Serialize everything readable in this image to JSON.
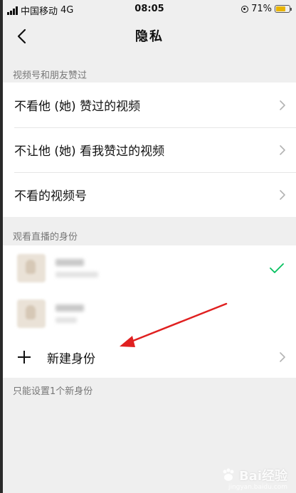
{
  "status_bar": {
    "carrier": "中国移动",
    "network": "4G",
    "time": "08:05",
    "battery": "71%",
    "battery_level": 0.71
  },
  "nav": {
    "title": "隐私"
  },
  "section_likes": {
    "header": "视频号和朋友赞过",
    "rows": [
      {
        "label": "不看他 (她) 赞过的视频"
      },
      {
        "label": "不让他 (她) 看我赞过的视频"
      },
      {
        "label": "不看的视频号"
      }
    ]
  },
  "section_identity": {
    "header": "观看直播的身份",
    "identities": [
      {
        "name": "",
        "selected": true
      },
      {
        "name": "",
        "selected": false
      }
    ],
    "new_identity_label": "新建身份"
  },
  "footer_note": "只能设置1个新身份",
  "colors": {
    "background": "#efefef",
    "check_green": "#07c160",
    "arrow_red": "#e02020"
  },
  "watermark": {
    "text": "Bai经验",
    "sub": "jingyan.baidu.com"
  }
}
